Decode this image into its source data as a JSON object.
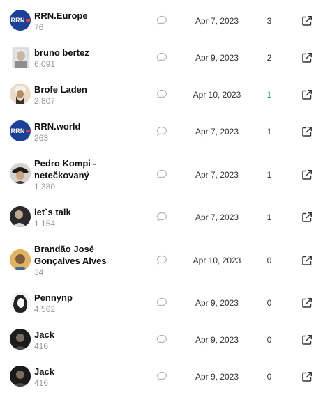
{
  "colors": {
    "rrn_blue": "#1c3f97",
    "count_gray": "#9a9a9a",
    "icon_gray": "#b5b5b5",
    "teal": "#2a9d8f"
  },
  "rows": [
    {
      "name": "RRN.Europe",
      "count": "76",
      "date": "Apr 7, 2023",
      "number": "3",
      "avatar": "rrn-logo",
      "avatar_text": "RRN"
    },
    {
      "name": "bruno bertez",
      "count": "6,091",
      "date": "Apr 9, 2023",
      "number": "2",
      "avatar": "photo"
    },
    {
      "name": "Brofe Laden",
      "count": "2,807",
      "date": "Apr 10, 2023",
      "number": "1",
      "avatar": "photo"
    },
    {
      "name": "RRN.world",
      "count": "263",
      "date": "Apr 7, 2023",
      "number": "1",
      "avatar": "rrn-logo",
      "avatar_text": "RRN"
    },
    {
      "name": "Pedro Kompi - netečkovaný",
      "count": "1,380",
      "date": "Apr 7, 2023",
      "number": "1",
      "avatar": "photo"
    },
    {
      "name": "let`s talk",
      "count": "1,154",
      "date": "Apr 7, 2023",
      "number": "1",
      "avatar": "photo"
    },
    {
      "name": "Brandão José Gonçalves Alves",
      "count": "34",
      "date": "Apr 10, 2023",
      "number": "0",
      "avatar": "photo"
    },
    {
      "name": "Pennynp",
      "count": "4,562",
      "date": "Apr 9, 2023",
      "number": "0",
      "avatar": "photo"
    },
    {
      "name": "Jack",
      "count": "416",
      "date": "Apr 9, 2023",
      "number": "0",
      "avatar": "photo"
    },
    {
      "name": "Jack",
      "count": "416",
      "date": "Apr 9, 2023",
      "number": "0",
      "avatar": "photo"
    }
  ]
}
